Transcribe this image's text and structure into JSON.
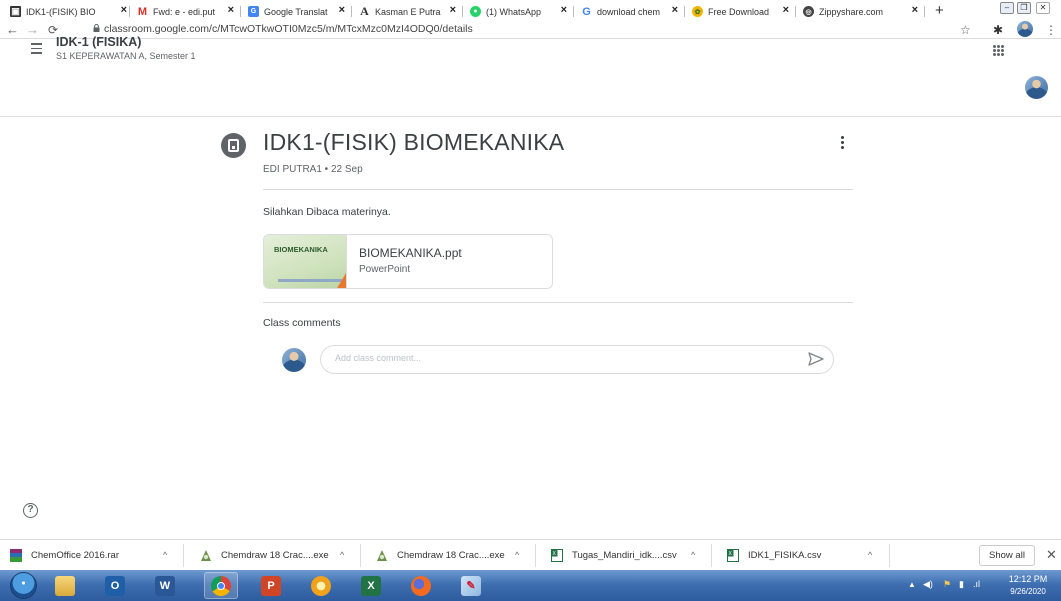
{
  "browser": {
    "tabs": [
      {
        "label": "IDK1-(FISIK) BIO",
        "favicon": "classroom-icon",
        "active": true
      },
      {
        "label": "Fwd: e - edi.put",
        "favicon": "gmail-icon"
      },
      {
        "label": "Google Translat",
        "favicon": "translate-icon"
      },
      {
        "label": "Kasman E Putra",
        "favicon": "academia-icon"
      },
      {
        "label": "(1) WhatsApp",
        "favicon": "whatsapp-icon"
      },
      {
        "label": "download chem",
        "favicon": "google-icon"
      },
      {
        "label": "Free Download",
        "favicon": "download-site-icon"
      },
      {
        "label": "Zippyshare.com",
        "favicon": "zippyshare-icon"
      }
    ],
    "new_tab_label": "+",
    "url": "classroom.google.com/c/MTcwOTkwOTI0Mzc5/m/MTcxMzc0MzI4ODQ0/details"
  },
  "classroom": {
    "class_title": "IDK-1 (FISIKA)",
    "class_subtitle": "S1 KEPERAWATAN A, Semester 1"
  },
  "post": {
    "title": "IDK1-(FISIK) BIOMEKANIKA",
    "meta": "EDI PUTRA1 • 22 Sep",
    "description": "Silahkan Dibaca materinya.",
    "attachment": {
      "thumb_title": "BIOMEKANIKA",
      "name": "BIOMEKANIKA.ppt",
      "type": "PowerPoint"
    },
    "comments_label": "Class comments",
    "comment_placeholder": "Add class comment..."
  },
  "help_icon_glyph": "?",
  "downloads": {
    "items": [
      {
        "name": "ChemOffice 2016.rar"
      },
      {
        "name": "Chemdraw 18 Crac....exe"
      },
      {
        "name": "Chemdraw 18 Crac....exe"
      },
      {
        "name": "Tugas_Mandiri_idk....csv"
      },
      {
        "name": "IDK1_FISIKA.csv"
      }
    ],
    "show_all": "Show all"
  },
  "taskbar": {
    "time": "12:12 PM",
    "date": "9/26/2020"
  },
  "colors": {
    "accent_text": "#3c4043",
    "muted_text": "#5f6368",
    "taskbar": "#3f6fb0"
  }
}
